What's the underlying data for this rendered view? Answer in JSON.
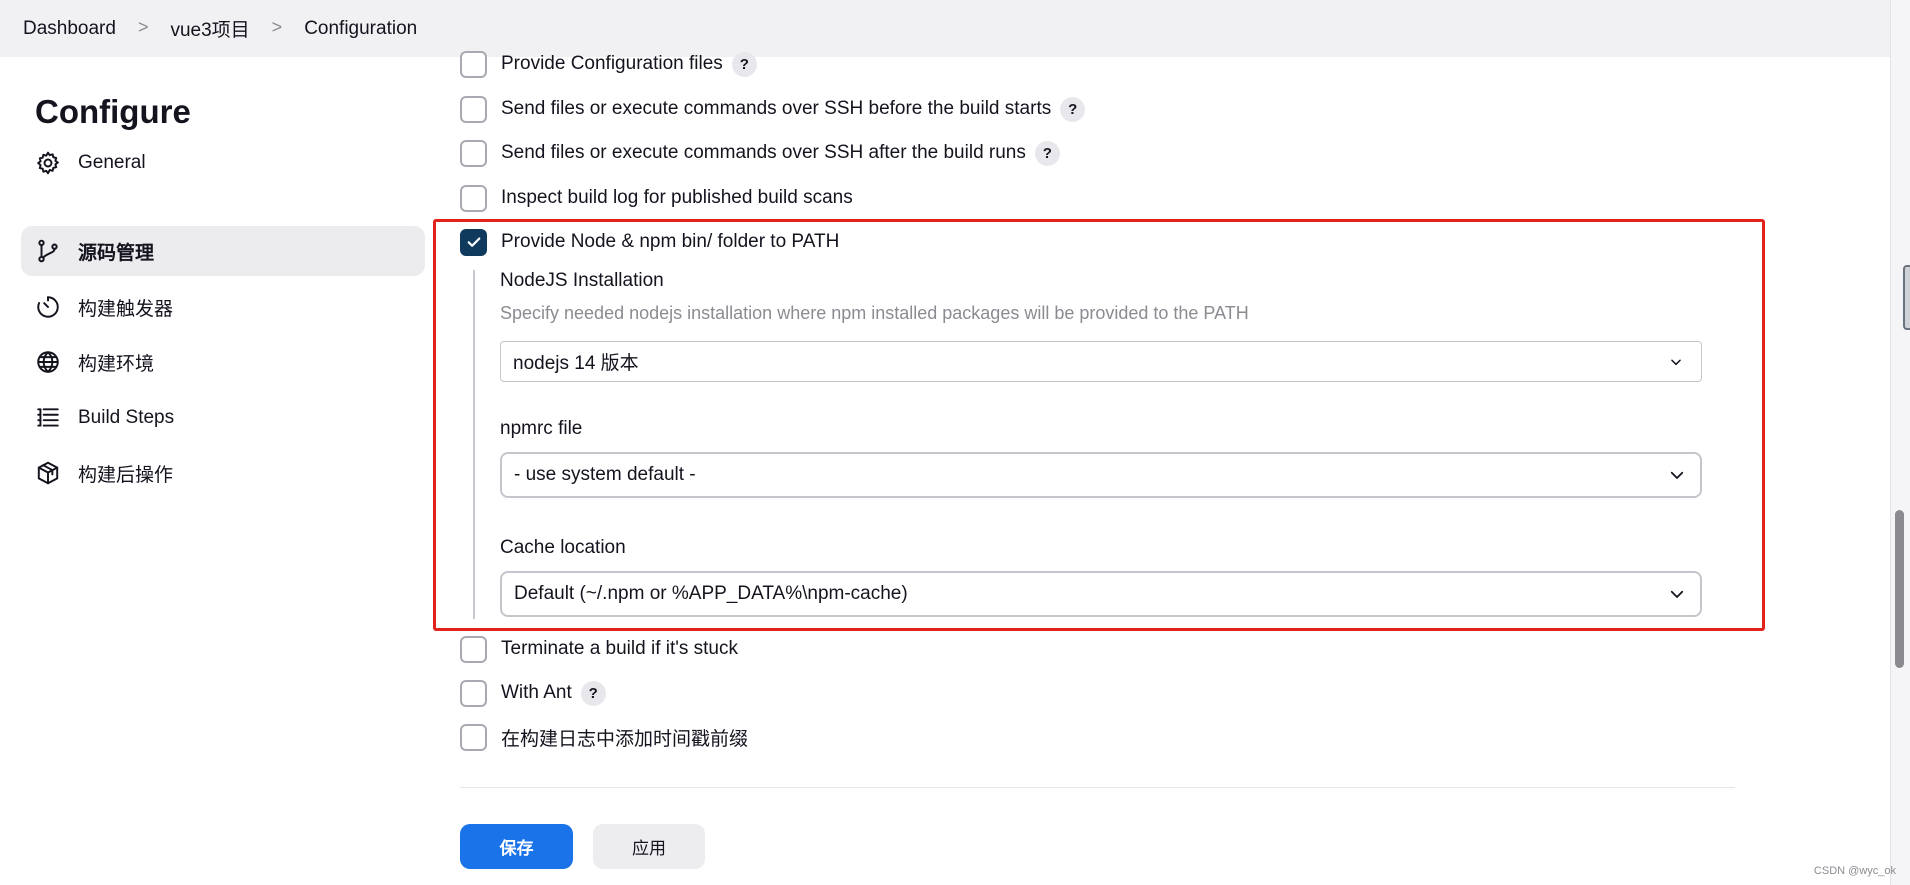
{
  "breadcrumb": {
    "items": [
      "Dashboard",
      "vue3项目",
      "Configuration"
    ],
    "separator": ">"
  },
  "sidebar": {
    "title": "Configure",
    "items": [
      {
        "label": "General",
        "icon": "gear-icon"
      },
      {
        "label": "源码管理",
        "icon": "branch-icon",
        "active": true
      },
      {
        "label": "构建触发器",
        "icon": "timer-icon"
      },
      {
        "label": "构建环境",
        "icon": "globe-icon"
      },
      {
        "label": "Build Steps",
        "icon": "list-icon"
      },
      {
        "label": "构建后操作",
        "icon": "package-icon"
      }
    ]
  },
  "options": {
    "provide_config_files": {
      "label": "Provide Configuration files",
      "checked": false,
      "help": "?"
    },
    "ssh_before": {
      "label": "Send files or execute commands over SSH before the build starts",
      "checked": false,
      "help": "?"
    },
    "ssh_after": {
      "label": "Send files or execute commands over SSH after the build runs",
      "checked": false,
      "help": "?"
    },
    "inspect_log": {
      "label": "Inspect build log for published build scans",
      "checked": false
    },
    "node_path": {
      "label": "Provide Node & npm bin/ folder to PATH",
      "checked": true
    },
    "terminate_stuck": {
      "label": "Terminate a build if it's stuck",
      "checked": false
    },
    "with_ant": {
      "label": "With Ant",
      "checked": false,
      "help": "?"
    },
    "timestamps": {
      "label": "在构建日志中添加时间戳前缀",
      "checked": false
    }
  },
  "node_config": {
    "nodejs_installation": {
      "label": "NodeJS Installation",
      "description": "Specify needed nodejs installation where npm installed packages will be provided to the PATH",
      "value": "nodejs 14 版本"
    },
    "npmrc_file": {
      "label": "npmrc file",
      "value": "- use system default -"
    },
    "cache_location": {
      "label": "Cache location",
      "value": "Default (~/.npm or %APP_DATA%\\npm-cache)"
    }
  },
  "actions": {
    "save_label": "保存",
    "apply_label": "应用"
  },
  "colors": {
    "highlight_border": "#e2231a",
    "checkbox_checked": "#0f3a5e",
    "primary_button": "#1a73e8"
  },
  "watermark": "CSDN @wyc_ok"
}
